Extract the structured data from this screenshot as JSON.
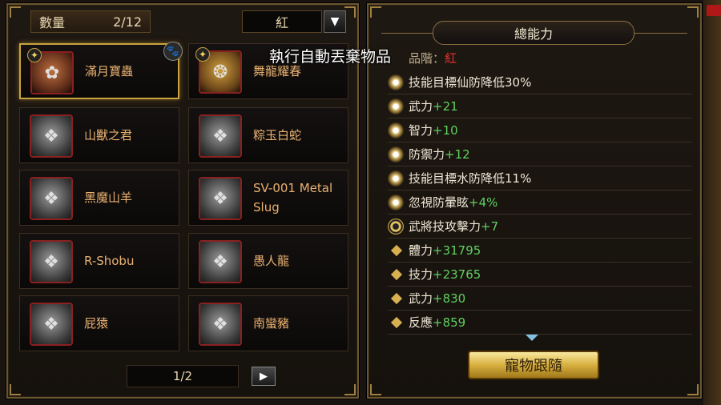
{
  "left_panel": {
    "count_label": "數量",
    "count_value": "2/12",
    "filter_value": "紅",
    "filter_arrow": "▼",
    "pets": [
      {
        "name": "滿月寶蟲",
        "icon": "✦",
        "selected": true
      },
      {
        "name": "舞龍耀春",
        "icon": "✦",
        "selected": false
      },
      {
        "name": "山獸之君",
        "icon": "",
        "selected": false
      },
      {
        "name": "粽玉白蛇",
        "icon": "",
        "selected": false
      },
      {
        "name": "黑魔山羊",
        "icon": "",
        "selected": false
      },
      {
        "name": "SV-001 Metal Slug",
        "icon": "",
        "selected": false
      },
      {
        "name": "R-Shobu",
        "icon": "",
        "selected": false
      },
      {
        "name": "愚人龍",
        "icon": "",
        "selected": false
      },
      {
        "name": "屁猿",
        "icon": "",
        "selected": false
      },
      {
        "name": "南蠻豬",
        "icon": "",
        "selected": false
      }
    ],
    "paw_icon": "paw-icon",
    "page": "1/2",
    "next_arrow": "▶"
  },
  "right_panel": {
    "title": "總能力",
    "overlay_message": "執行自動丟棄物品",
    "grade_label": "品階：",
    "grade_value": "紅",
    "stats": [
      {
        "label": "技能目標仙防降低30%",
        "bonus": "",
        "icon": "star"
      },
      {
        "label": "武力",
        "bonus": "+21",
        "icon": "star"
      },
      {
        "label": "智力",
        "bonus": "+10",
        "icon": "star"
      },
      {
        "label": "防禦力",
        "bonus": "+12",
        "icon": "star"
      },
      {
        "label": "技能目標水防降低11%",
        "bonus": "",
        "icon": "star"
      },
      {
        "label": "忽視防暈眩",
        "bonus": "+4%",
        "icon": "star"
      },
      {
        "label": "武將技攻擊力",
        "bonus": "+7",
        "icon": "ring"
      },
      {
        "label": "體力",
        "bonus": "+31795",
        "icon": "diamond"
      },
      {
        "label": "技力",
        "bonus": "+23765",
        "icon": "diamond"
      },
      {
        "label": "武力",
        "bonus": "+830",
        "icon": "diamond"
      },
      {
        "label": "反應",
        "bonus": "+859",
        "icon": "diamond"
      }
    ],
    "follow_button": "寵物跟隨"
  }
}
